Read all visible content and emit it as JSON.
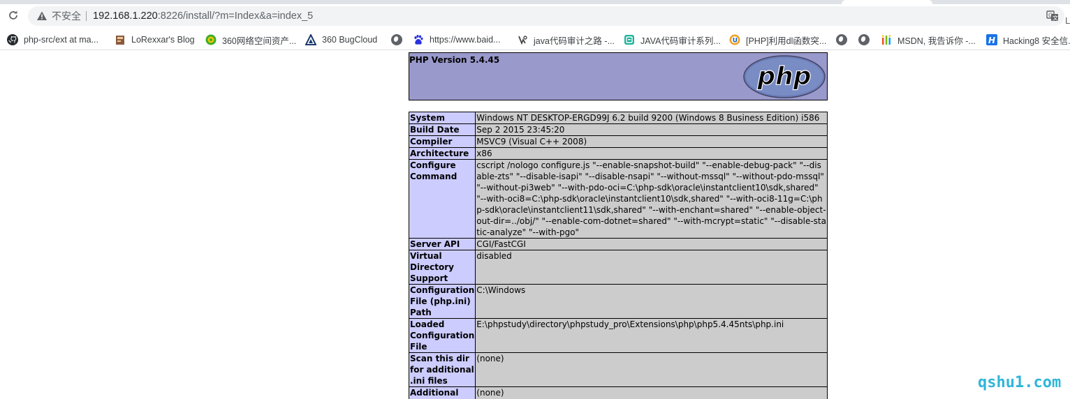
{
  "browser": {
    "security_label": "不安全",
    "url_host": "192.168.1.220",
    "url_rest": ":8226/install/?m=Index&a=index_5",
    "edge_char": "L"
  },
  "bookmarks": [
    {
      "label": "php-src/ext at ma...",
      "icon": "github-icon"
    },
    {
      "label": "LoRexxar's Blog",
      "icon": "blog-icon"
    },
    {
      "label": "360网络空间资产...",
      "icon": "360-icon"
    },
    {
      "label": "360 BugCloud",
      "icon": "bugcloud-icon"
    },
    {
      "label": "",
      "icon": "globe-icon"
    },
    {
      "label": "https://www.baid...",
      "icon": "baidu-icon"
    },
    {
      "label": "java代码审计之路 -...",
      "icon": "java-icon"
    },
    {
      "label": "JAVA代码审计系列...",
      "icon": "doc-icon"
    },
    {
      "label": "[PHP]利用dl函数突...",
      "icon": "php-bookmark-icon"
    },
    {
      "label": "",
      "icon": "globe-icon"
    },
    {
      "label": "",
      "icon": "globe-icon"
    },
    {
      "label": "MSDN, 我告诉你 -...",
      "icon": "msdn-icon"
    },
    {
      "label": "Hacking8 安全信...",
      "icon": "hacking8-icon"
    }
  ],
  "phpinfo": {
    "title": "PHP Version 5.4.45",
    "logo_text": "php",
    "rows": [
      {
        "key": "System",
        "value": "Windows NT DESKTOP-ERGD99J 6.2 build 9200 (Windows 8 Business Edition) i586"
      },
      {
        "key": "Build Date",
        "value": "Sep 2 2015 23:45:20"
      },
      {
        "key": "Compiler",
        "value": "MSVC9 (Visual C++ 2008)"
      },
      {
        "key": "Architecture",
        "value": "x86"
      },
      {
        "key": "Configure Command",
        "value": "cscript /nologo configure.js \"--enable-snapshot-build\" \"--enable-debug-pack\" \"--disable-zts\" \"--disable-isapi\" \"--disable-nsapi\" \"--without-mssql\" \"--without-pdo-mssql\" \"--without-pi3web\" \"--with-pdo-oci=C:\\php-sdk\\oracle\\instantclient10\\sdk,shared\" \"--with-oci8=C:\\php-sdk\\oracle\\instantclient10\\sdk,shared\" \"--with-oci8-11g=C:\\php-sdk\\oracle\\instantclient11\\sdk,shared\" \"--with-enchant=shared\" \"--enable-object-out-dir=../obj/\" \"--enable-com-dotnet=shared\" \"--with-mcrypt=static\" \"--disable-static-analyze\" \"--with-pgo\""
      },
      {
        "key": "Server API",
        "value": "CGI/FastCGI"
      },
      {
        "key": "Virtual Directory Support",
        "value": "disabled"
      },
      {
        "key": "Configuration File (php.ini) Path",
        "value": "C:\\Windows"
      },
      {
        "key": "Loaded Configuration File",
        "value": "E:\\phpstudy\\directory\\phpstudy_pro\\Extensions\\php\\php5.4.45nts\\php.ini"
      },
      {
        "key": "Scan this dir for additional .ini files",
        "value": "(none)"
      },
      {
        "key": "Additional .ini",
        "value": "(none)"
      }
    ]
  },
  "watermark": "qshu1.com",
  "colors": {
    "header_bg": "#9999cc",
    "key_bg": "#ccccff",
    "value_bg": "#cccccc",
    "watermark": "#2fb6d9"
  }
}
